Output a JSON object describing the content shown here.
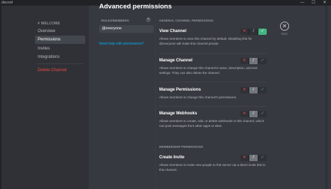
{
  "window": {
    "app_title": "discord",
    "minimize_glyph": "—",
    "maximize_glyph": "☐",
    "close_glyph": "✕"
  },
  "sidebar": {
    "server_name": "# WELCOME",
    "items": [
      {
        "label": "Overview",
        "active": false
      },
      {
        "label": "Permissions",
        "active": true
      },
      {
        "label": "Invites",
        "active": false
      },
      {
        "label": "Integrations",
        "active": false
      },
      {
        "label": "Delete Channel",
        "danger": true
      }
    ]
  },
  "page": {
    "title": "Advanced permissions",
    "title_chevron": "⌄"
  },
  "roles": {
    "header": "ROLES/MEMBERS",
    "add_glyph": "+",
    "items": [
      "@everyone"
    ],
    "help_link": "Need help with permissions?"
  },
  "sections": {
    "general": "GENERAL CHANNEL PERMISSIONS",
    "membership": "MEMBERSHIP PERMISSIONS"
  },
  "permissions": [
    {
      "name": "View Channel",
      "description": "Allows members to view this channel by default. Disabling this for @everyone will make this channel private.",
      "state": "allow"
    },
    {
      "name": "Manage Channel",
      "description": "Allows members to change this channel's name, description, and text settings. They can also delete the channel.",
      "state": "neutral"
    },
    {
      "name": "Manage Permissions",
      "description": "Allows members to change this channel's permissions.",
      "state": "neutral"
    },
    {
      "name": "Manage Webhooks",
      "description": "Allows members to create, edit, or delete webhooks in this channel, which can post messages from other apps or sites.",
      "state": "neutral"
    },
    {
      "name": "Create Invite",
      "description": "Allows members to invite new people to this server via a direct invite link to this channel.",
      "state": "neutral"
    }
  ],
  "toggle": {
    "deny_glyph": "✕",
    "neutral_glyph": "/",
    "allow_glyph": "✓"
  },
  "close": {
    "glyph": "✕",
    "label": "ESC"
  },
  "colors": {
    "background": "#36393f",
    "sidebar": "#2f3136",
    "deny": "#f04747",
    "allow": "#43b581",
    "link": "#00b0f4"
  }
}
